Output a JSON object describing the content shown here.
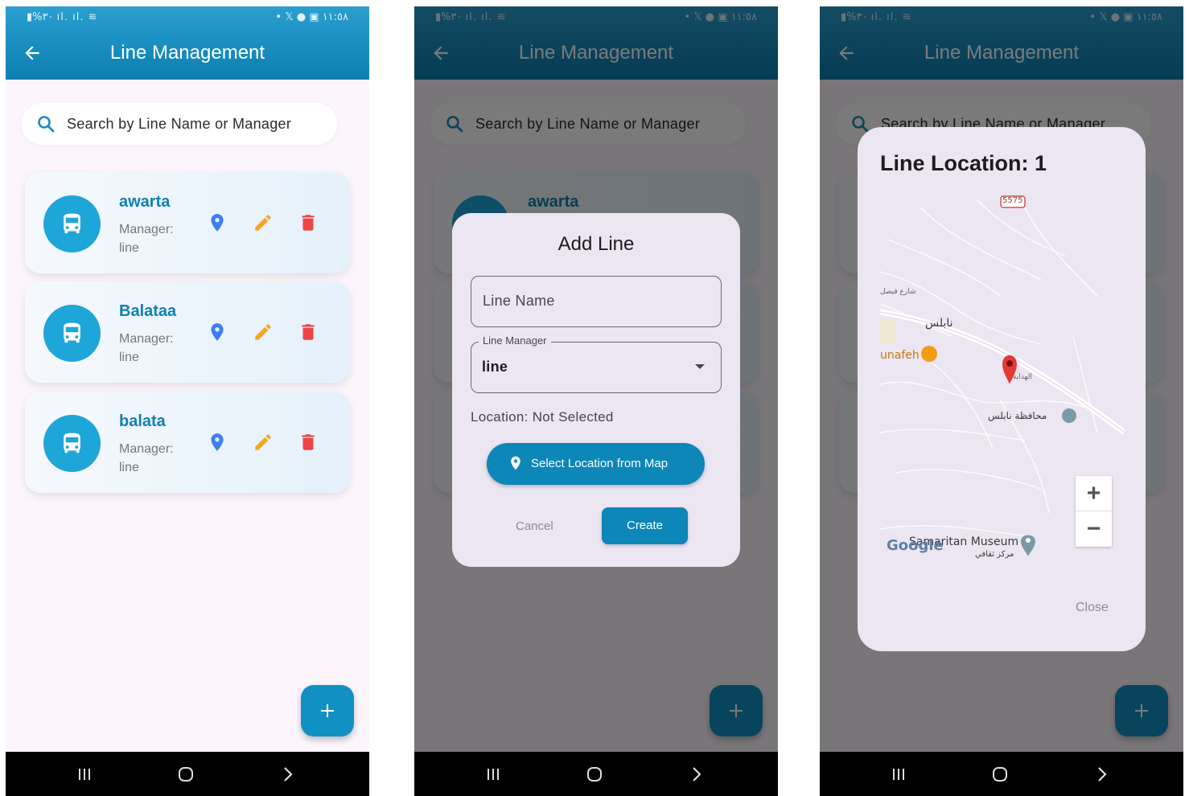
{
  "status_bar": {
    "left": "▮%٣٠ ıl. ıl. ≋",
    "right": "• 𝕏 ● ▣ ١١:٥٨"
  },
  "app_bar": {
    "title": "Line Management"
  },
  "search": {
    "placeholder": "Search by Line Name or Manager"
  },
  "lines": [
    {
      "name": "awarta",
      "manager_label": "Manager:",
      "manager": "line"
    },
    {
      "name": "Balataa",
      "manager_label": "Manager:",
      "manager": "line"
    },
    {
      "name": "balata",
      "manager_label": "Manager:",
      "manager": "line"
    }
  ],
  "add_dialog": {
    "title": "Add Line",
    "line_name_placeholder": "Line Name",
    "line_manager_label": "Line Manager",
    "line_manager_value": "line",
    "location_status": "Location: Not Selected",
    "select_location_label": "Select Location from Map",
    "cancel_label": "Cancel",
    "create_label": "Create"
  },
  "map_dialog": {
    "title": "Line Location: 1",
    "labels": {
      "road_number": "5575",
      "city": "نابلس",
      "restaurant": "unafeh",
      "governorate": "محافظة نابلس",
      "museum": "Samaritan Museum",
      "museum_sub": "مركز ثقافي",
      "road_a": "شارع فيصل",
      "road_b": "الهداية",
      "google": "Google"
    },
    "zoom_in": "+",
    "zoom_out": "−",
    "close_label": "Close"
  },
  "colors": {
    "primary": "#0d86b8",
    "accent": "#1ea6d8",
    "pin_blue": "#3d7ff2",
    "edit_orange": "#f5a623",
    "delete_red": "#ef4444"
  },
  "icons": {
    "back": "arrow-left-icon",
    "search": "search-icon",
    "bus": "bus-icon",
    "location": "location-pin-icon",
    "edit": "pencil-icon",
    "delete": "trash-icon",
    "add": "plus-icon"
  }
}
